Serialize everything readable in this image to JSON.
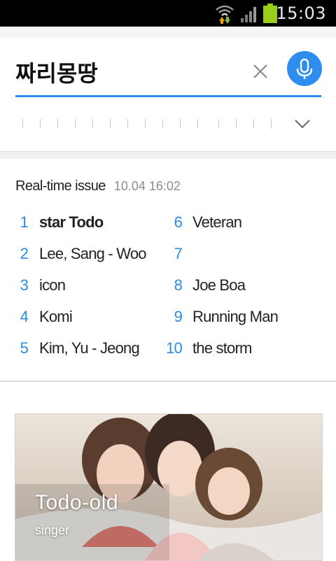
{
  "status_bar": {
    "time": "15:03",
    "icons": [
      "wifi-icon",
      "signal-icon",
      "battery-icon"
    ],
    "battery_color": "#9acd1a"
  },
  "search": {
    "query": "짜리몽땅",
    "accent_color": "#2b8be6",
    "mic_color": "#2e8ef0"
  },
  "realtime": {
    "title": "Real-time issue",
    "timestamp": "10.04 16:02",
    "items": [
      {
        "rank": "1",
        "label": "star Todo"
      },
      {
        "rank": "2",
        "label": "Lee, Sang - Woo"
      },
      {
        "rank": "3",
        "label": "icon"
      },
      {
        "rank": "4",
        "label": "Komi"
      },
      {
        "rank": "5",
        "label": "Kim, Yu - Jeong"
      },
      {
        "rank": "6",
        "label": "Veteran"
      },
      {
        "rank": "7",
        "label": ""
      },
      {
        "rank": "8",
        "label": "Joe Boa"
      },
      {
        "rank": "9",
        "label": "Running Man"
      },
      {
        "rank": "10",
        "label": "the storm"
      }
    ]
  },
  "card": {
    "title": "Todo-old",
    "subtitle": "singer"
  }
}
